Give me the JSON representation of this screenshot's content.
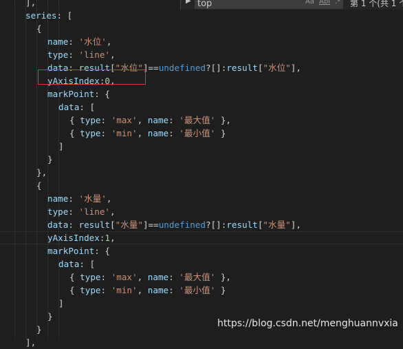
{
  "find_widget": {
    "query": "top",
    "match_case_label": "Aa",
    "whole_word_label": "Abl",
    "regex_label": ".*",
    "count_text": "第 1 个(共 1 个"
  },
  "code_lines": [
    [
      {
        "t": "],",
        "c": "pun"
      }
    ],
    [
      {
        "t": "series",
        "c": "key"
      },
      {
        "t": ": [",
        "c": "pun"
      }
    ],
    [
      {
        "t": "{",
        "c": "pun"
      }
    ],
    [
      {
        "t": "name",
        "c": "key"
      },
      {
        "t": ": ",
        "c": "pun"
      },
      {
        "t": "'水位'",
        "c": "str"
      },
      {
        "t": ",",
        "c": "pun"
      }
    ],
    [
      {
        "t": "type",
        "c": "key"
      },
      {
        "t": ": ",
        "c": "pun"
      },
      {
        "t": "'line'",
        "c": "str"
      },
      {
        "t": ",",
        "c": "pun"
      }
    ],
    [
      {
        "t": "data",
        "c": "key"
      },
      {
        "t": ": ",
        "c": "pun"
      },
      {
        "t": "result",
        "c": "key"
      },
      {
        "t": "[",
        "c": "pun"
      },
      {
        "t": "\"水位\"",
        "c": "str"
      },
      {
        "t": "]==",
        "c": "pun"
      },
      {
        "t": "undefined",
        "c": "kw"
      },
      {
        "t": "?[]:",
        "c": "pun"
      },
      {
        "t": "result",
        "c": "key"
      },
      {
        "t": "[",
        "c": "pun"
      },
      {
        "t": "\"水位\"",
        "c": "str"
      },
      {
        "t": "],",
        "c": "pun"
      }
    ],
    [
      {
        "t": "yAxisIndex",
        "c": "key"
      },
      {
        "t": ":",
        "c": "pun"
      },
      {
        "t": "0",
        "c": "num"
      },
      {
        "t": ",",
        "c": "pun"
      }
    ],
    [
      {
        "t": "markPoint",
        "c": "key"
      },
      {
        "t": ": {",
        "c": "pun"
      }
    ],
    [
      {
        "t": "data",
        "c": "key"
      },
      {
        "t": ": [",
        "c": "pun"
      }
    ],
    [
      {
        "t": "{ ",
        "c": "pun"
      },
      {
        "t": "type",
        "c": "key"
      },
      {
        "t": ": ",
        "c": "pun"
      },
      {
        "t": "'max'",
        "c": "str"
      },
      {
        "t": ", ",
        "c": "pun"
      },
      {
        "t": "name",
        "c": "key"
      },
      {
        "t": ": ",
        "c": "pun"
      },
      {
        "t": "'最大值'",
        "c": "str"
      },
      {
        "t": " },",
        "c": "pun"
      }
    ],
    [
      {
        "t": "{ ",
        "c": "pun"
      },
      {
        "t": "type",
        "c": "key"
      },
      {
        "t": ": ",
        "c": "pun"
      },
      {
        "t": "'min'",
        "c": "str"
      },
      {
        "t": ", ",
        "c": "pun"
      },
      {
        "t": "name",
        "c": "key"
      },
      {
        "t": ": ",
        "c": "pun"
      },
      {
        "t": "'最小值'",
        "c": "str"
      },
      {
        "t": " }",
        "c": "pun"
      }
    ],
    [
      {
        "t": "]",
        "c": "pun"
      }
    ],
    [
      {
        "t": "}",
        "c": "pun"
      }
    ],
    [
      {
        "t": "},",
        "c": "pun"
      }
    ],
    [
      {
        "t": "{",
        "c": "pun"
      }
    ],
    [
      {
        "t": "name",
        "c": "key"
      },
      {
        "t": ": ",
        "c": "pun"
      },
      {
        "t": "'水量'",
        "c": "str"
      },
      {
        "t": ",",
        "c": "pun"
      }
    ],
    [
      {
        "t": "type",
        "c": "key"
      },
      {
        "t": ": ",
        "c": "pun"
      },
      {
        "t": "'line'",
        "c": "str"
      },
      {
        "t": ",",
        "c": "pun"
      }
    ],
    [
      {
        "t": "data",
        "c": "key"
      },
      {
        "t": ": ",
        "c": "pun"
      },
      {
        "t": "result",
        "c": "key"
      },
      {
        "t": "[",
        "c": "pun"
      },
      {
        "t": "\"水量\"",
        "c": "str"
      },
      {
        "t": "]==",
        "c": "pun"
      },
      {
        "t": "undefined",
        "c": "kw"
      },
      {
        "t": "?[]:",
        "c": "pun"
      },
      {
        "t": "result",
        "c": "key"
      },
      {
        "t": "[",
        "c": "pun"
      },
      {
        "t": "\"水量\"",
        "c": "str"
      },
      {
        "t": "],",
        "c": "pun"
      }
    ],
    [
      {
        "t": "yAxisIndex",
        "c": "key"
      },
      {
        "t": ":",
        "c": "pun"
      },
      {
        "t": "1",
        "c": "num"
      },
      {
        "t": ",",
        "c": "pun"
      }
    ],
    [
      {
        "t": "markPoint",
        "c": "key"
      },
      {
        "t": ": {",
        "c": "pun"
      }
    ],
    [
      {
        "t": "data",
        "c": "key"
      },
      {
        "t": ": [",
        "c": "pun"
      }
    ],
    [
      {
        "t": "{ ",
        "c": "pun"
      },
      {
        "t": "type",
        "c": "key"
      },
      {
        "t": ": ",
        "c": "pun"
      },
      {
        "t": "'max'",
        "c": "str"
      },
      {
        "t": ", ",
        "c": "pun"
      },
      {
        "t": "name",
        "c": "key"
      },
      {
        "t": ": ",
        "c": "pun"
      },
      {
        "t": "'最大值'",
        "c": "str"
      },
      {
        "t": " },",
        "c": "pun"
      }
    ],
    [
      {
        "t": "{ ",
        "c": "pun"
      },
      {
        "t": "type",
        "c": "key"
      },
      {
        "t": ": ",
        "c": "pun"
      },
      {
        "t": "'min'",
        "c": "str"
      },
      {
        "t": ", ",
        "c": "pun"
      },
      {
        "t": "name",
        "c": "key"
      },
      {
        "t": ": ",
        "c": "pun"
      },
      {
        "t": "'最小值'",
        "c": "str"
      },
      {
        "t": " }",
        "c": "pun"
      }
    ],
    [
      {
        "t": "]",
        "c": "pun"
      }
    ],
    [
      {
        "t": "}",
        "c": "pun"
      }
    ],
    [
      {
        "t": "}",
        "c": "pun"
      }
    ],
    [
      {
        "t": "],",
        "c": "pun"
      }
    ]
  ],
  "watermark": "https://blog.csdn.net/menghuannvxia"
}
